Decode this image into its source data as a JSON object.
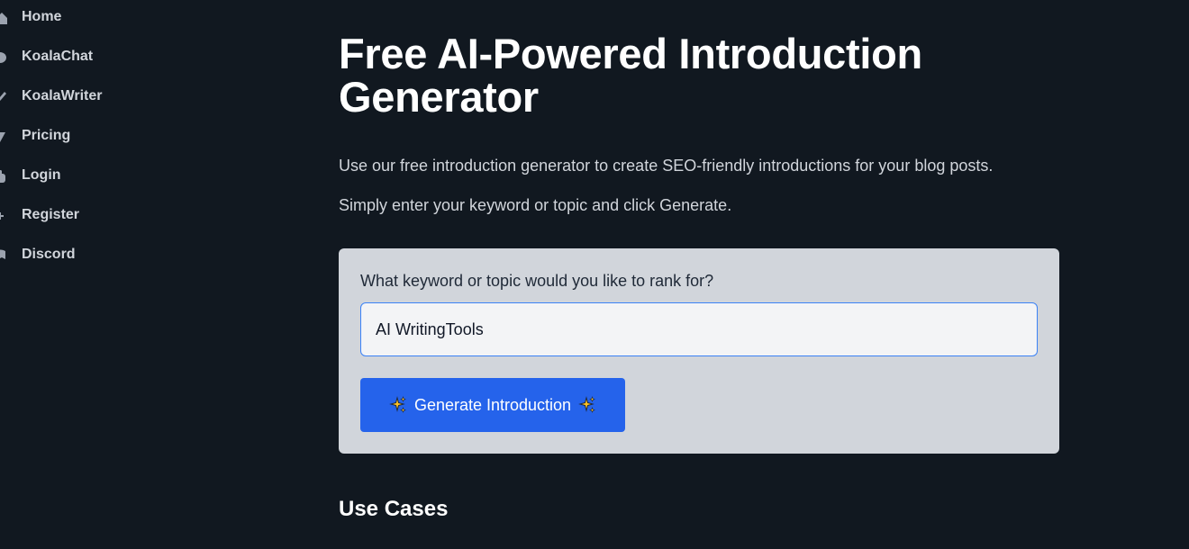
{
  "sidebar": {
    "items": [
      {
        "label": "Home",
        "icon": "home-icon"
      },
      {
        "label": "KoalaChat",
        "icon": "chat-icon"
      },
      {
        "label": "KoalaWriter",
        "icon": "pen-icon"
      },
      {
        "label": "Pricing",
        "icon": "tag-icon"
      },
      {
        "label": "Login",
        "icon": "hand-icon"
      },
      {
        "label": "Register",
        "icon": "user-plus-icon"
      },
      {
        "label": "Discord",
        "icon": "discord-icon"
      }
    ]
  },
  "main": {
    "title": "Free AI-Powered Introduction Generator",
    "intro_1": "Use our free introduction generator to create SEO-friendly introductions for your blog posts.",
    "intro_2": "Simply enter your keyword or topic and click Generate."
  },
  "form": {
    "label": "What keyword or topic would you like to rank for?",
    "input_value": "AI WritingTools",
    "button_label": "Generate Introduction",
    "button_icon": "sparkles-icon"
  },
  "section": {
    "use_cases_title": "Use Cases"
  },
  "colors": {
    "background": "#111820",
    "card": "#d1d5db",
    "accent": "#2563eb"
  }
}
